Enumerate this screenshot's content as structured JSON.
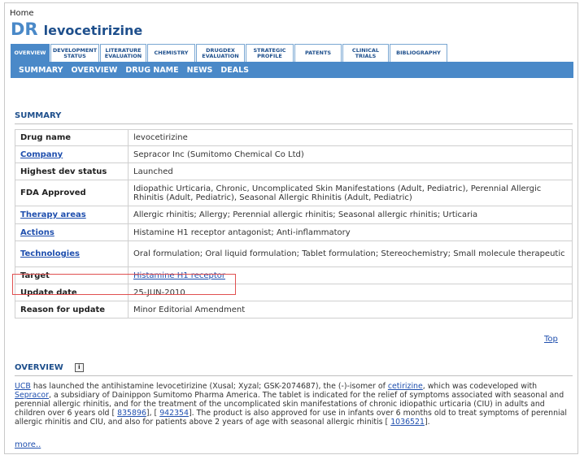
{
  "breadcrumb": "Home",
  "title": {
    "prefix": "DR",
    "drug": "levocetirizine"
  },
  "tabs": [
    {
      "l1": "OVERVIEW",
      "l2": ""
    },
    {
      "l1": "DEVELOPMENT",
      "l2": "STATUS"
    },
    {
      "l1": "LITERATURE",
      "l2": "EVALUATION"
    },
    {
      "l1": "CHEMISTRY",
      "l2": ""
    },
    {
      "l1": "DRUGDEX",
      "l2": "EVALUATION"
    },
    {
      "l1": "STRATEGIC",
      "l2": "PROFILE"
    },
    {
      "l1": "PATENTS",
      "l2": ""
    },
    {
      "l1": "CLINICAL",
      "l2": "TRIALS"
    },
    {
      "l1": "BIBLIOGRAPHY",
      "l2": ""
    }
  ],
  "subnav": [
    "SUMMARY",
    "OVERVIEW",
    "DRUG NAME",
    "NEWS",
    "DEALS"
  ],
  "summary": {
    "heading": "SUMMARY",
    "rows": [
      {
        "label": "Drug name",
        "value": "levocetirizine"
      },
      {
        "label": "Company",
        "value": "Sepracor Inc (Sumitomo Chemical Co Ltd)"
      },
      {
        "label": "Highest dev status",
        "value": "Launched"
      },
      {
        "label": "FDA Approved",
        "value": "Idiopathic Urticaria, Chronic, Uncomplicated Skin Manifestations (Adult, Pediatric), Perennial Allergic Rhinitis (Adult, Pediatric), Seasonal Allergic Rhinitis (Adult, Pediatric)"
      },
      {
        "label": "Therapy areas",
        "value": "Allergic rhinitis; Allergy; Perennial allergic rhinitis; Seasonal allergic rhinitis; Urticaria"
      },
      {
        "label": "Actions",
        "value": "Histamine H1 receptor antagonist; Anti-inflammatory"
      },
      {
        "label": "Technologies",
        "value": "Oral formulation; Oral liquid formulation; Tablet formulation; Stereochemistry; Small molecule therapeutic"
      },
      {
        "label": "Target",
        "value": "Histamine H1 receptor"
      },
      {
        "label": "Update date",
        "value": "25-JUN-2010"
      },
      {
        "label": "Reason for update",
        "value": "Minor Editorial Amendment"
      }
    ]
  },
  "top_link": "Top",
  "overview": {
    "heading": "OVERVIEW",
    "info_icon": "i",
    "p1": "UCB",
    "p2": " has launched the antihistamine levocetirizine (Xusal; Xyzal; GSK-2074687), the (-)-isomer of ",
    "p3": "cetirizine",
    "p4": ", which was codeveloped with ",
    "p5": "Sepracor",
    "p6": ", a subsidiary of Dainippon Sumitomo Pharma America. The tablet is indicated for the relief of symptoms associated with seasonal and perennial allergic rhinitis, and for the treatment of the uncomplicated skin manifestations of chronic idiopathic urticaria (CIU) in adults and children over 6 years old [ ",
    "p7": "835896",
    "p8": "], [ ",
    "p9": "942354",
    "p10": "]. The product is also approved for use in infants over 6 months old to treat symptoms of perennial allergic rhinitis and CIU, and also for patients above 2 years of age with seasonal allergic rhinitis [ ",
    "p11": "1036521",
    "p12": "].",
    "more": "more.."
  }
}
